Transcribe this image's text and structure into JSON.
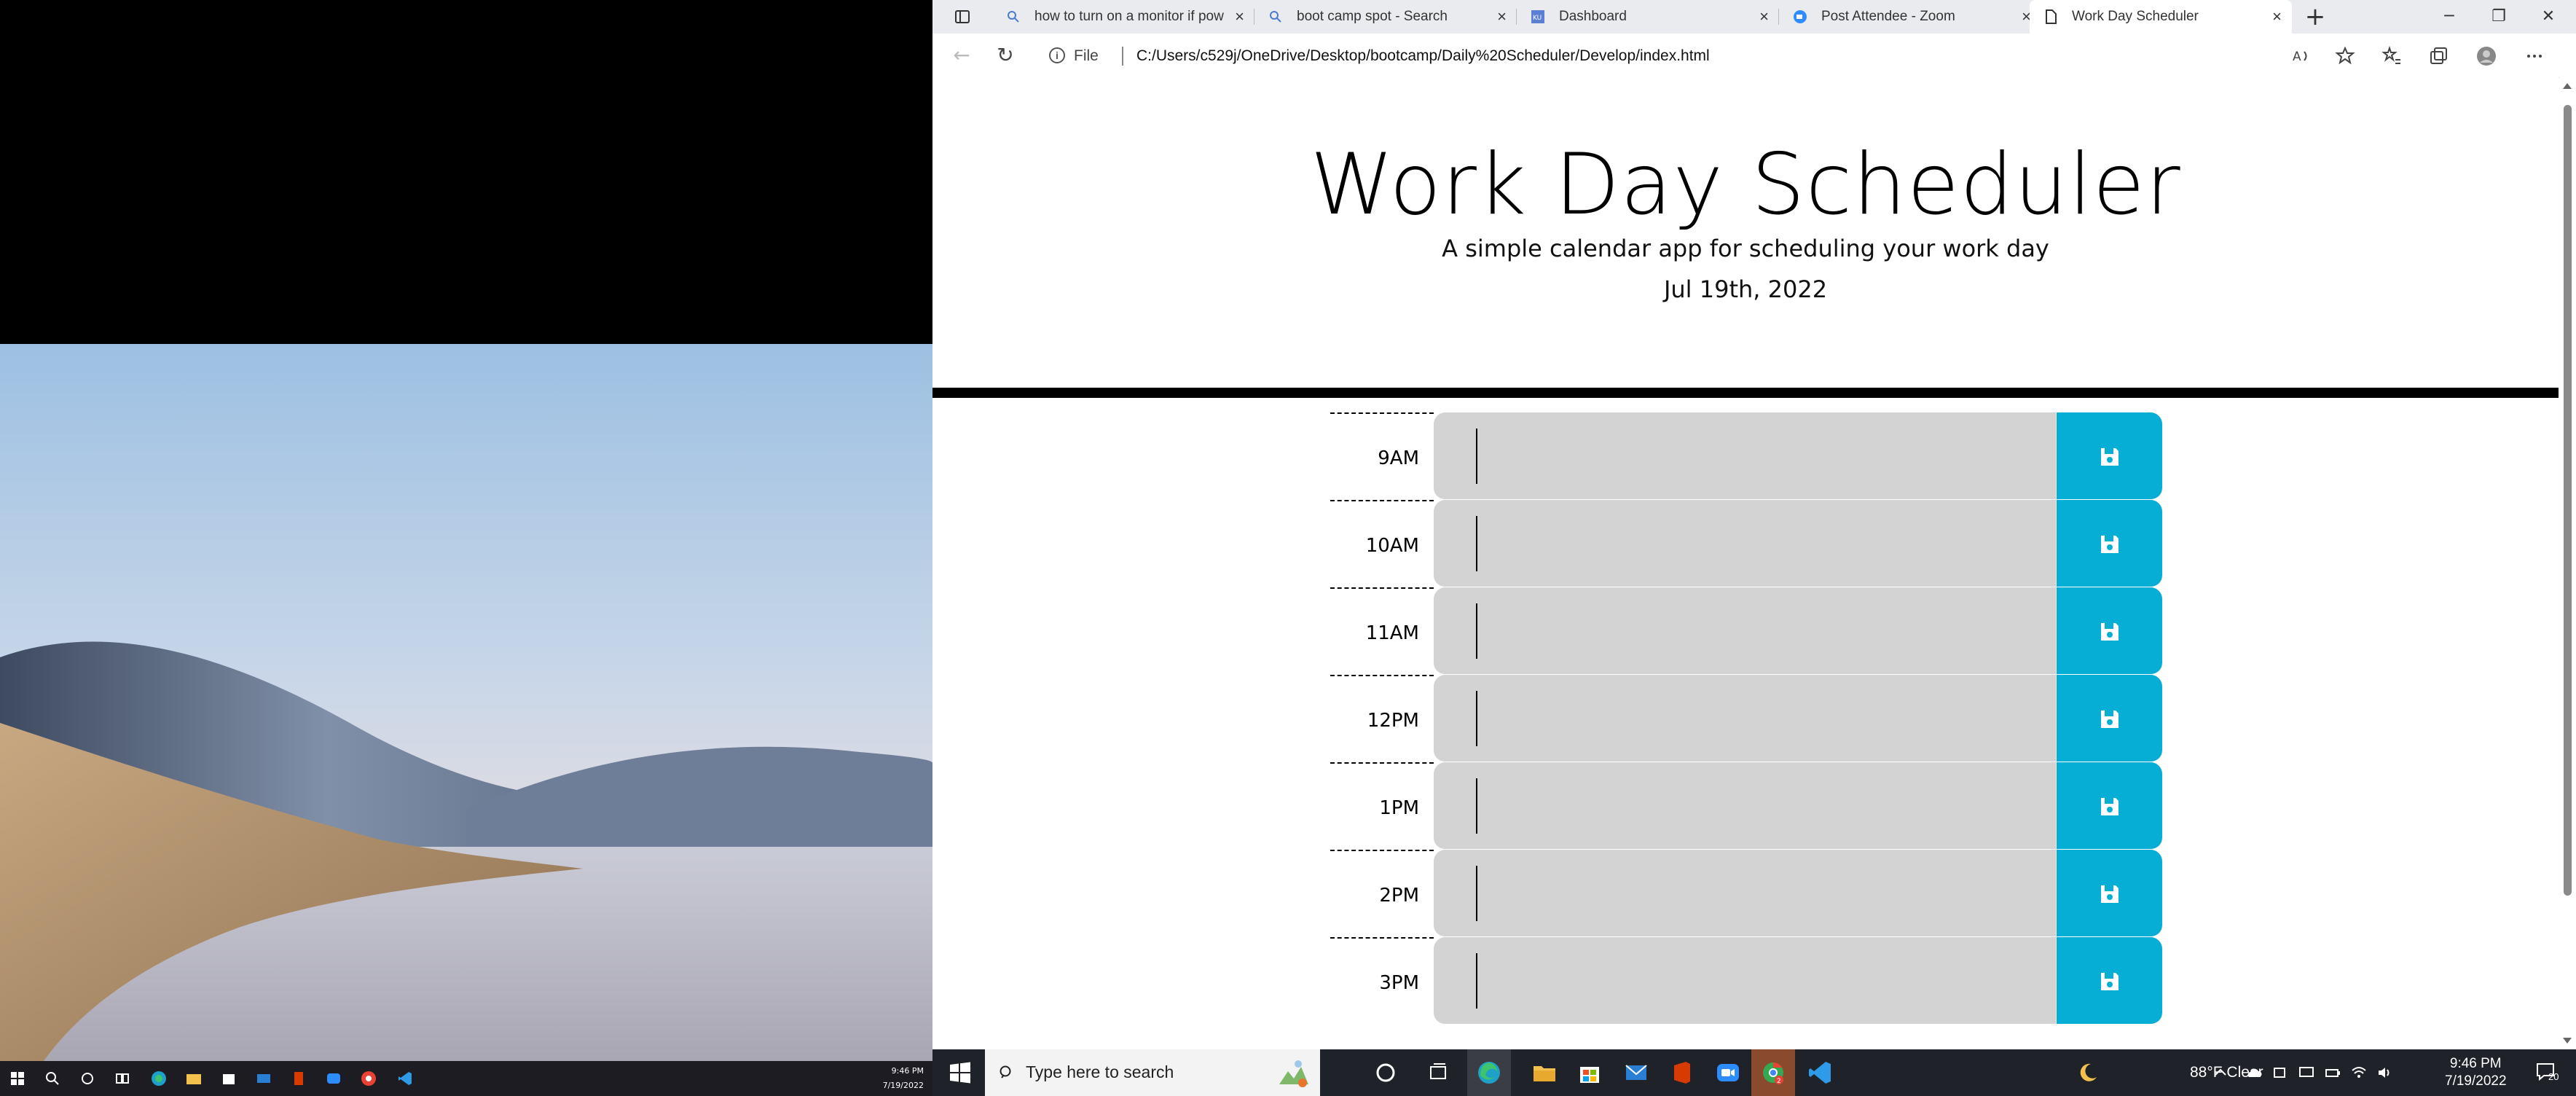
{
  "left_clock": {
    "time": "9:46 PM",
    "date": "7/19/2022"
  },
  "browser": {
    "tabs": [
      {
        "title": "how to turn on a monitor if pow",
        "icon": "search-icon"
      },
      {
        "title": "boot camp spot - Search",
        "icon": "search-icon"
      },
      {
        "title": "Dashboard",
        "icon": "bootcamp-icon"
      },
      {
        "title": "Post Attendee - Zoom",
        "icon": "zoom-icon"
      },
      {
        "title": "Work Day Scheduler",
        "icon": "page-icon",
        "active": true
      }
    ],
    "address": {
      "scheme": "File",
      "url": "C:/Users/c529j/OneDrive/Desktop/bootcamp/Daily%20Scheduler/Develop/index.html"
    }
  },
  "page": {
    "title": "Work Day Scheduler",
    "subtitle": "A simple calendar app for scheduling your work day",
    "current_day": "Jul 19th, 2022",
    "hours": [
      "9AM",
      "10AM",
      "11AM",
      "12PM",
      "1PM",
      "2PM",
      "3PM"
    ],
    "colors": {
      "past": "#d3d3d3",
      "save_button": "#06aed5"
    }
  },
  "taskbar": {
    "search_placeholder": "Type here to search",
    "weather": "88°F  Clear",
    "time": "9:46 PM",
    "date": "7/19/2022",
    "notification_count": "20"
  }
}
